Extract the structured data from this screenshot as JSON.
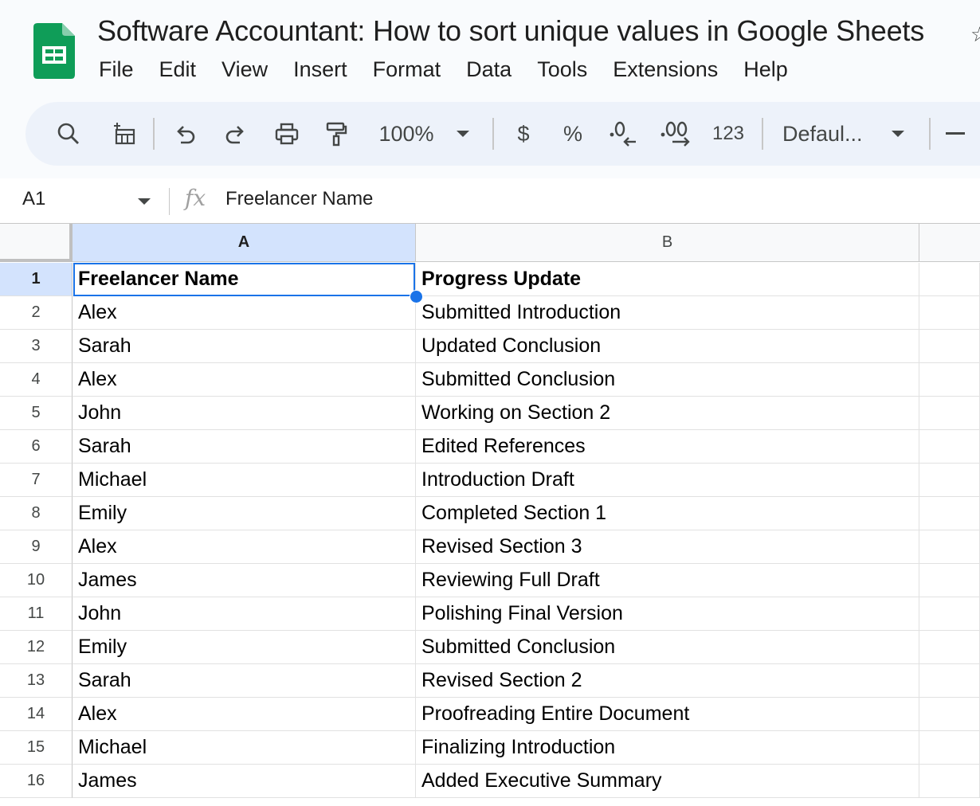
{
  "app": {
    "title": "Software Accountant: How to sort unique values in Google Sheets",
    "menu": [
      "File",
      "Edit",
      "View",
      "Insert",
      "Format",
      "Data",
      "Tools",
      "Extensions",
      "Help"
    ]
  },
  "toolbar": {
    "zoom": "100%",
    "currency": "$",
    "percent": "%",
    "number_format": "123",
    "font": "Defaul...",
    "font_size_minus": "−"
  },
  "formula_bar": {
    "cell_ref": "A1",
    "fx": "fx",
    "content": "Freelancer Name"
  },
  "sheet": {
    "columns": [
      "A",
      "B"
    ],
    "selected_cell": "A1",
    "rows": [
      {
        "num": "1",
        "a": "Freelancer Name",
        "b": "Progress Update"
      },
      {
        "num": "2",
        "a": "Alex",
        "b": "Submitted Introduction"
      },
      {
        "num": "3",
        "a": "Sarah",
        "b": "Updated Conclusion"
      },
      {
        "num": "4",
        "a": "Alex",
        "b": "Submitted Conclusion"
      },
      {
        "num": "5",
        "a": "John",
        "b": "Working on Section 2"
      },
      {
        "num": "6",
        "a": "Sarah",
        "b": "Edited References"
      },
      {
        "num": "7",
        "a": "Michael",
        "b": "Introduction Draft"
      },
      {
        "num": "8",
        "a": "Emily",
        "b": "Completed Section 1"
      },
      {
        "num": "9",
        "a": "Alex",
        "b": "Revised Section 3"
      },
      {
        "num": "10",
        "a": "James",
        "b": "Reviewing Full Draft"
      },
      {
        "num": "11",
        "a": "John",
        "b": "Polishing Final Version"
      },
      {
        "num": "12",
        "a": "Emily",
        "b": "Submitted Conclusion"
      },
      {
        "num": "13",
        "a": "Sarah",
        "b": "Revised Section 2"
      },
      {
        "num": "14",
        "a": "Alex",
        "b": "Proofreading Entire Document"
      },
      {
        "num": "15",
        "a": "Michael",
        "b": "Finalizing Introduction"
      },
      {
        "num": "16",
        "a": "James",
        "b": "Added Executive Summary"
      }
    ]
  },
  "colors": {
    "accent": "#1a73e8",
    "sheets_green": "#0f9d58",
    "header_selected": "#d3e3fd",
    "toolbar_bg": "#edf2fa"
  }
}
